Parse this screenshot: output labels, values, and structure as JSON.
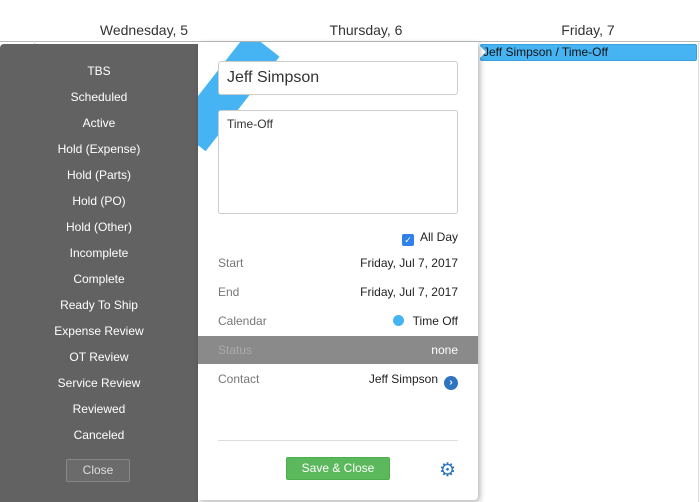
{
  "calendar": {
    "days": [
      "Wednesday, 5",
      "Thursday, 6",
      "Friday, 7"
    ],
    "event": {
      "label": "Jeff Simpson / Time-Off",
      "color": "#46b4f2"
    }
  },
  "status_menu": {
    "items": [
      "TBS",
      "Scheduled",
      "Active",
      "Hold (Expense)",
      "Hold (Parts)",
      "Hold (PO)",
      "Hold (Other)",
      "Incomplete",
      "Complete",
      "Ready To Ship",
      "Expense Review",
      "OT Review",
      "Service Review",
      "Reviewed",
      "Canceled"
    ],
    "close_label": "Close"
  },
  "popup": {
    "title_value": "Jeff Simpson",
    "description_value": "Time-Off",
    "all_day_label": "All Day",
    "all_day_checked": true,
    "start_label": "Start",
    "start_value": "Friday, Jul 7, 2017",
    "end_label": "End",
    "end_value": "Friday, Jul 7, 2017",
    "calendar_label": "Calendar",
    "calendar_value": "Time Off",
    "calendar_color": "#46b4f2",
    "status_label": "Status",
    "status_value": "none",
    "contact_label": "Contact",
    "contact_value": "Jeff Simpson",
    "save_label": "Save & Close",
    "gear_icon": "gear-icon",
    "accent": "#5cb85c"
  }
}
